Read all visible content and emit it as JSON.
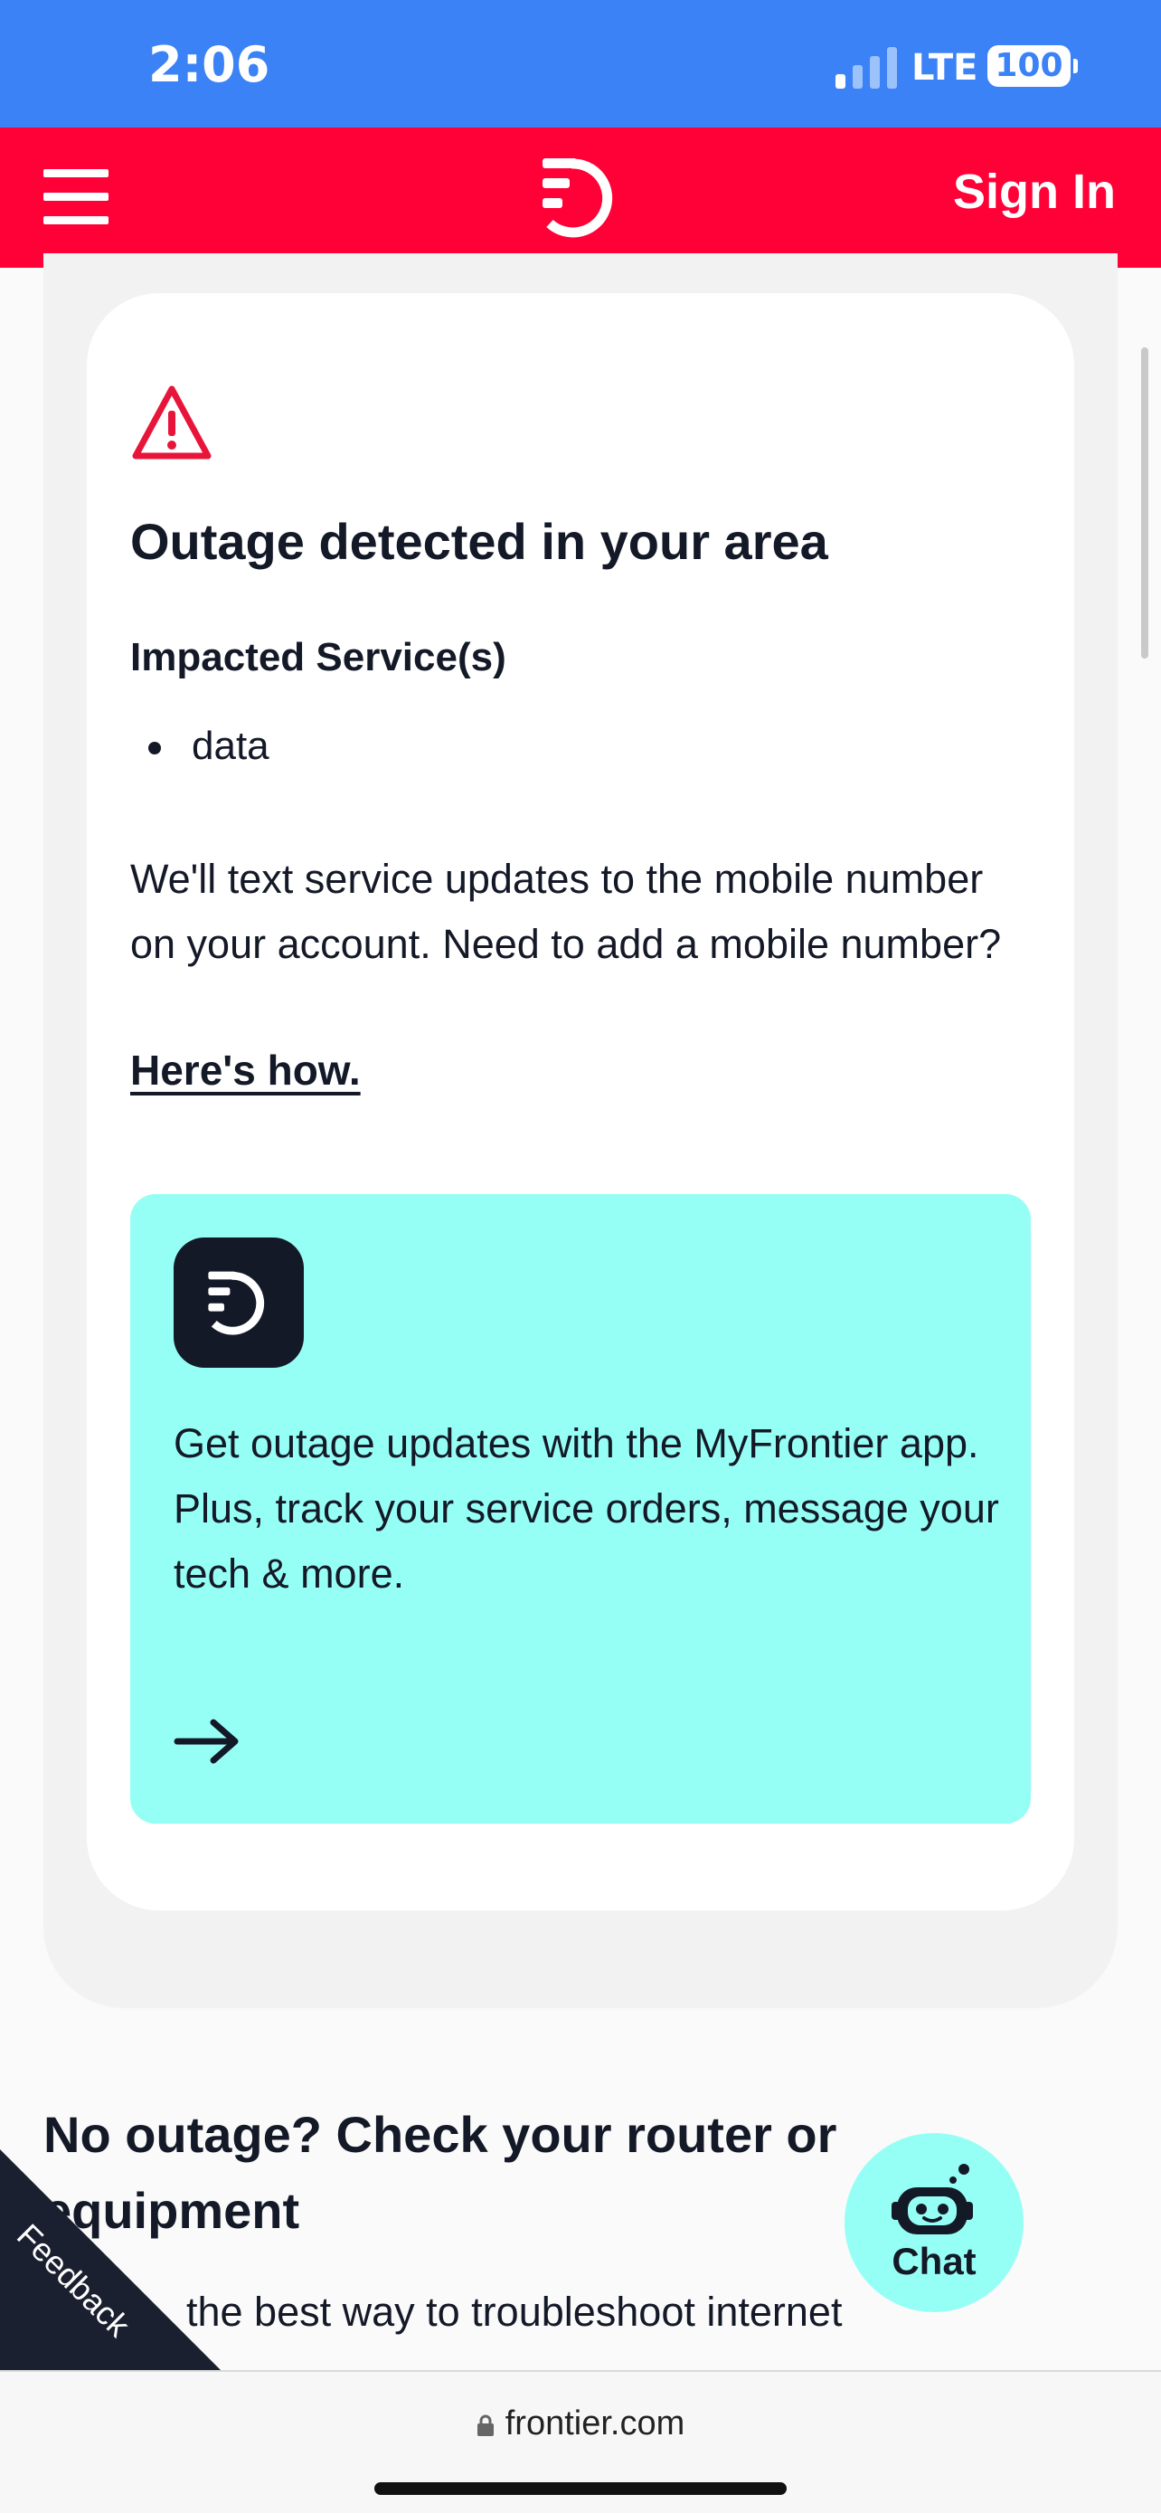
{
  "status_bar": {
    "time": "2:06",
    "network": "LTE",
    "battery": "100"
  },
  "nav": {
    "sign_in": "Sign In"
  },
  "outage": {
    "title": "Outage detected in your area",
    "impacted_label": "Impacted Service(s)",
    "services": [
      "data"
    ],
    "updates_text": "We'll text service updates to the mobile number on your account. Need to add a mobile number?",
    "link": "Here's how."
  },
  "app_promo": {
    "text": "Get outage updates with the MyFrontier app. Plus, track your service orders, message your tech & more."
  },
  "no_outage": {
    "title": "No outage? Check your router or equipment",
    "text": "the best way to troubleshoot internet"
  },
  "feedback": {
    "label": "Feedback"
  },
  "chat": {
    "label": "Chat"
  },
  "browser": {
    "url": "frontier.com"
  },
  "colors": {
    "brand_red": "#ff0037",
    "status_blue": "#3b82f6",
    "mint": "#96fff5",
    "navy": "#141928"
  }
}
